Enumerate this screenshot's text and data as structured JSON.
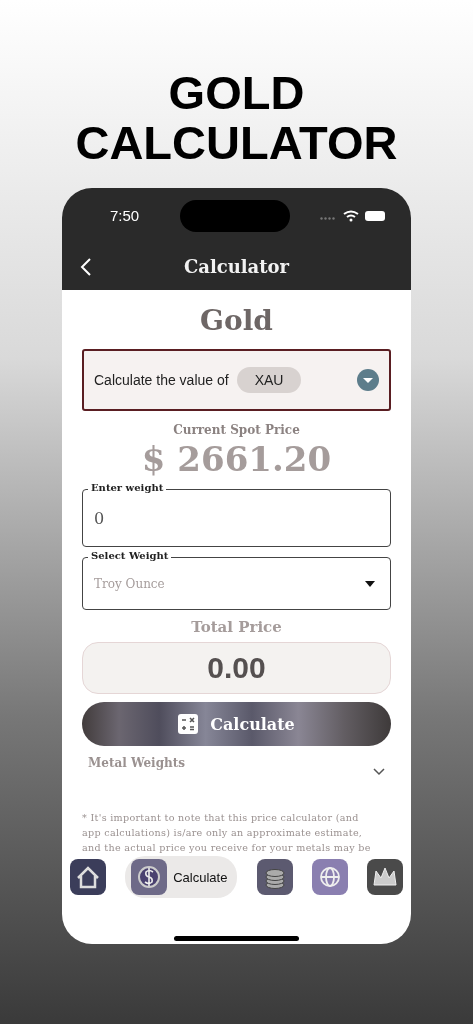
{
  "headline": "GOLD CALCULATOR",
  "status_bar": {
    "time": "7:50"
  },
  "nav_bar": {
    "title": "Calculator"
  },
  "metal_title": "Gold",
  "currency_picker": {
    "label": "Calculate the value of",
    "value": "XAU"
  },
  "spot_price": {
    "label": "Current Spot Price",
    "value": "$ 2661.20"
  },
  "weight_field": {
    "label": "Enter weight",
    "value": "0"
  },
  "unit_select": {
    "label": "Select Weight",
    "value": "Troy Ounce"
  },
  "total": {
    "label": "Total Price",
    "value": "0.00"
  },
  "calculate_button": "Calculate",
  "metal_weights": {
    "label": "Metal Weights",
    "expanded": false
  },
  "disclaimer": [
    "* It's important to note that this price calculator (and",
    "app calculations) is/are only an approximate estimate,",
    "and the actual price you receive for your metals may be"
  ],
  "tabs": [
    {
      "kind": "home",
      "selected": false
    },
    {
      "kind": "dollar",
      "label": "Calculate",
      "selected": true
    },
    {
      "kind": "coins",
      "selected": false
    },
    {
      "kind": "globe",
      "selected": false
    },
    {
      "kind": "crown",
      "selected": false
    }
  ]
}
